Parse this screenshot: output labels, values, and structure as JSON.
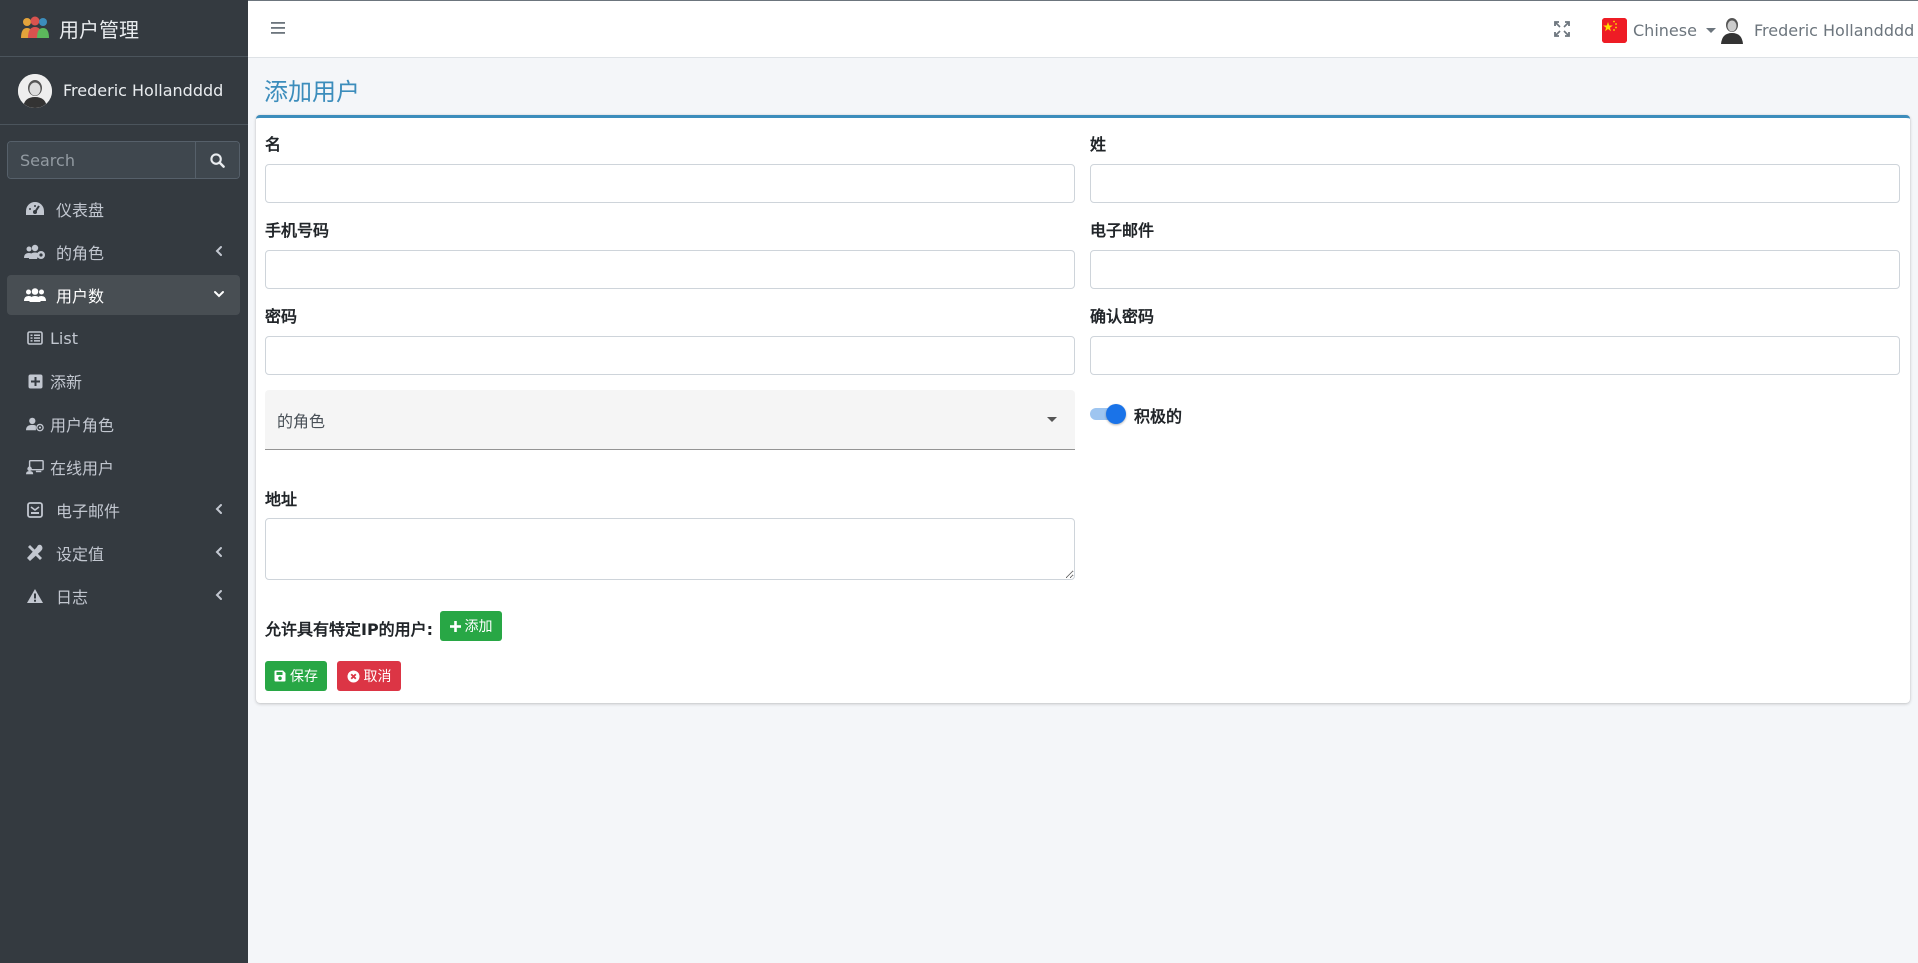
{
  "brand": {
    "title": "用户管理"
  },
  "sidebar": {
    "user_name": "Frederic Hollandddd",
    "search_placeholder": "Search",
    "items": [
      {
        "label": "仪表盘",
        "icon": "dashboard-icon"
      },
      {
        "label": "的角色",
        "icon": "users-cog-icon"
      },
      {
        "label": "用户数",
        "icon": "users-icon",
        "active": true
      },
      {
        "label": "List",
        "icon": "list-icon"
      },
      {
        "label": "添新",
        "icon": "plus-square-icon"
      },
      {
        "label": "用户角色",
        "icon": "user-tag-icon"
      },
      {
        "label": "在线用户",
        "icon": "online-users-icon"
      },
      {
        "label": "电子邮件",
        "icon": "mail-bulk-icon"
      },
      {
        "label": "设定值",
        "icon": "tools-icon"
      },
      {
        "label": "日志",
        "icon": "warning-icon"
      }
    ]
  },
  "topbar": {
    "language": "Chinese",
    "user_name": "Frederic Hollandddd"
  },
  "page": {
    "title": "添加用户"
  },
  "form": {
    "first_name": {
      "label": "名",
      "value": ""
    },
    "last_name": {
      "label": "姓",
      "value": ""
    },
    "phone": {
      "label": "手机号码",
      "value": ""
    },
    "email": {
      "label": "电子邮件",
      "value": ""
    },
    "password": {
      "label": "密码",
      "value": ""
    },
    "confirm_password": {
      "label": "确认密码",
      "value": ""
    },
    "role": {
      "placeholder": "的角色"
    },
    "active": {
      "label": "积极的",
      "checked": true
    },
    "address": {
      "label": "地址",
      "value": ""
    },
    "ip_label": "允许具有特定IP的用户:",
    "add_button": "添加",
    "save_button": "保存",
    "cancel_button": "取消"
  },
  "colors": {
    "sidebar_bg": "#343a40",
    "accent": "#3c8dbc",
    "success": "#28a745",
    "danger": "#dc3545",
    "toggle": "#1a73e8"
  }
}
